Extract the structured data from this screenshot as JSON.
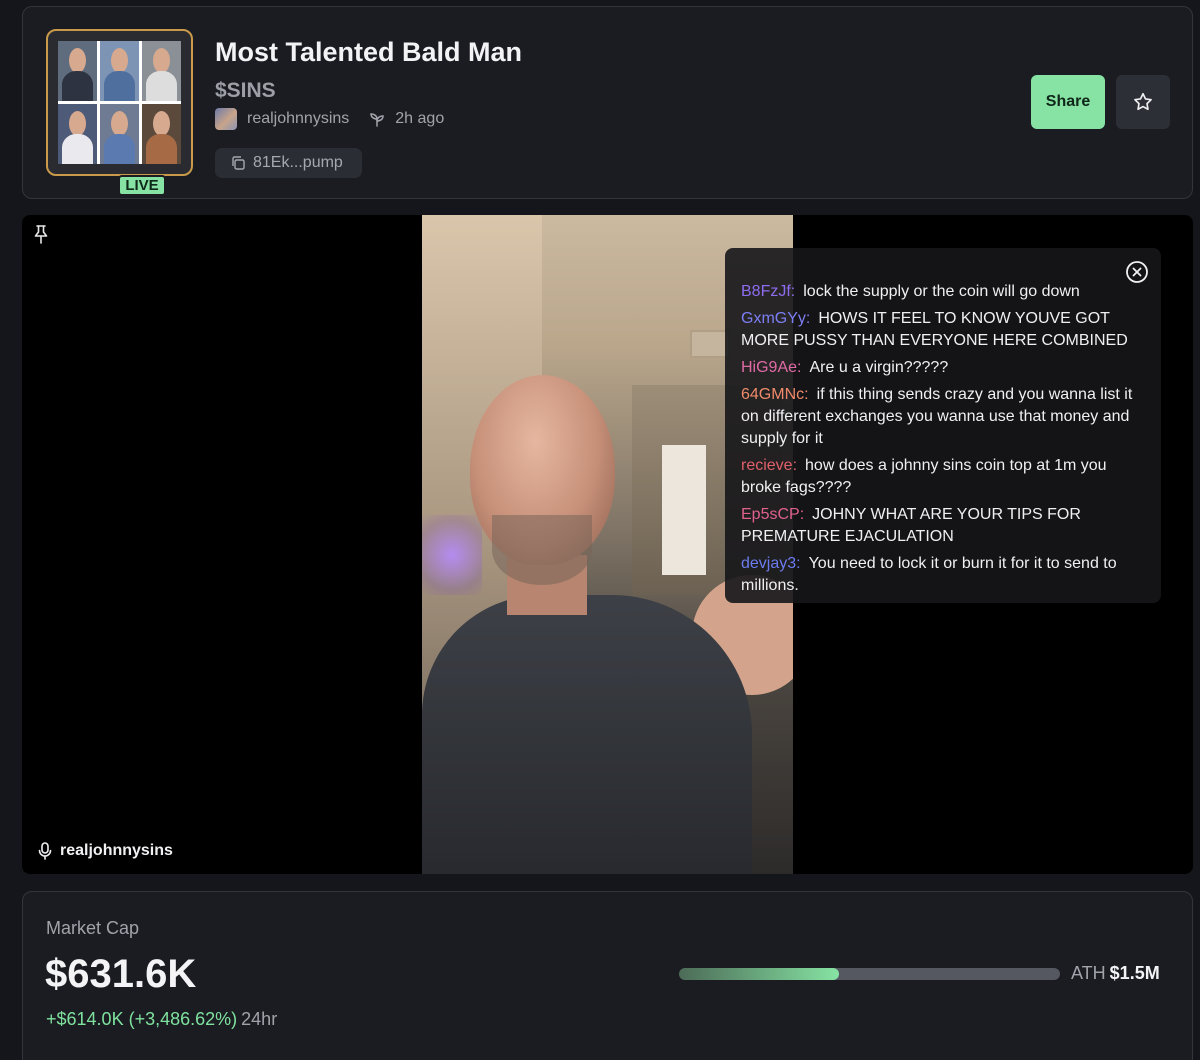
{
  "header": {
    "title": "Most Talented Bald Man",
    "ticker": "$SINS",
    "creator": "realjohnnysins",
    "age": "2h ago",
    "address": "81Ek...pump",
    "live_badge": "LIVE",
    "share_label": "Share",
    "thumbnail_tiles": [
      "Businessman",
      "Doctor",
      "Chemist",
      "Officer",
      "Teacher",
      "Bodybuilder"
    ]
  },
  "stream": {
    "streamer": "realjohnnysins",
    "chat": [
      {
        "user": "B8FzJf:",
        "color": "#8e6cf0",
        "text": "lock the supply or the coin will go down"
      },
      {
        "user": "GxmGYy:",
        "color": "#7c7ef5",
        "text": "HOWS IT FEEL TO KNOW YOUVE GOT MORE PUSSY THAN EVERYONE HERE COMBINED"
      },
      {
        "user": "HiG9Ae:",
        "color": "#e06aa6",
        "text": "Are u a virgin?????"
      },
      {
        "user": "64GMNc:",
        "color": "#f08a6a",
        "text": "if this thing sends crazy and you wanna list it on different exchanges you wanna use that money and supply for it"
      },
      {
        "user": "recieve:",
        "color": "#e0606a",
        "text": "how does a johnny sins coin top at 1m you broke fags????"
      },
      {
        "user": "Ep5sCP:",
        "color": "#e0608e",
        "text": "JOHNY WHAT ARE YOUR TIPS FOR PREMATURE EJACULATION"
      },
      {
        "user": "devjay3:",
        "color": "#6c7cf0",
        "text": "You need to lock it or burn it for it to send to millions."
      }
    ]
  },
  "market": {
    "label": "Market Cap",
    "value": "$631.6K",
    "change": "+$614.0K (+3,486.62%)",
    "period": "24hr",
    "ath_label": "ATH",
    "ath_value": "$1.5M",
    "ath_progress": 0.42
  },
  "colors": {
    "accent": "#86e3a3",
    "live_border": "#c99a4a",
    "positive": "#7ee29e"
  }
}
